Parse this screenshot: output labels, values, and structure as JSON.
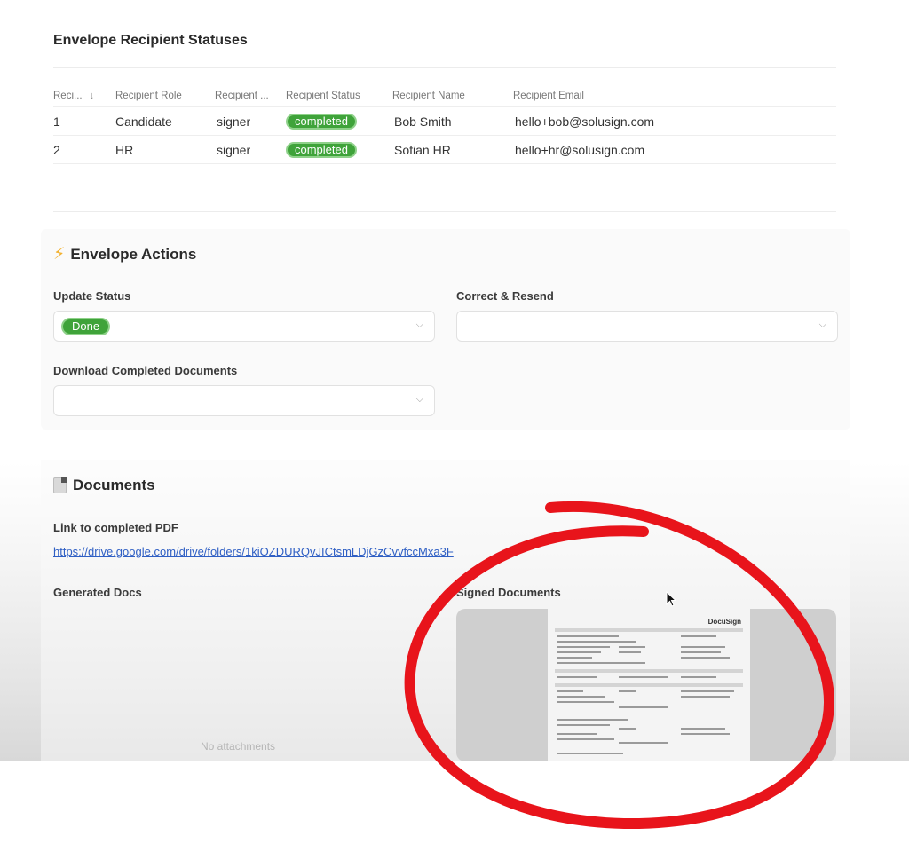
{
  "recipients": {
    "title": "Envelope Recipient Statuses",
    "columns": [
      "Reci...",
      "Recipient Role",
      "Recipient ...",
      "Recipient Status",
      "Recipient Name",
      "Recipient Email"
    ],
    "rows": [
      {
        "num": "1",
        "role": "Candidate",
        "type": "signer",
        "status": "completed",
        "name": "Bob Smith",
        "email": "hello+bob@solusign.com"
      },
      {
        "num": "2",
        "role": "HR",
        "type": "signer",
        "status": "completed",
        "name": "Sofian HR",
        "email": "hello+hr@solusign.com"
      }
    ]
  },
  "actions": {
    "title": "Envelope Actions",
    "icon": "lightning-icon",
    "update_status": {
      "label": "Update Status",
      "value": "Done"
    },
    "correct_resend": {
      "label": "Correct & Resend",
      "value": ""
    },
    "download": {
      "label": "Download Completed Documents",
      "value": ""
    }
  },
  "documents": {
    "title": "Documents",
    "icon": "document-icon",
    "link_label": "Link to completed PDF",
    "link_url": "https://drive.google.com/drive/folders/1kiOZDURQvJICtsmLDjGzCvvfccMxa3F",
    "generated_label": "Generated Docs",
    "generated_empty": "No attachments",
    "signed_label": "Signed Documents",
    "signed_preview_brand": "DocuSign"
  },
  "colors": {
    "status_green": "#3fa33a",
    "link_blue": "#2f5fc4",
    "annotation_red": "#e8141b"
  }
}
